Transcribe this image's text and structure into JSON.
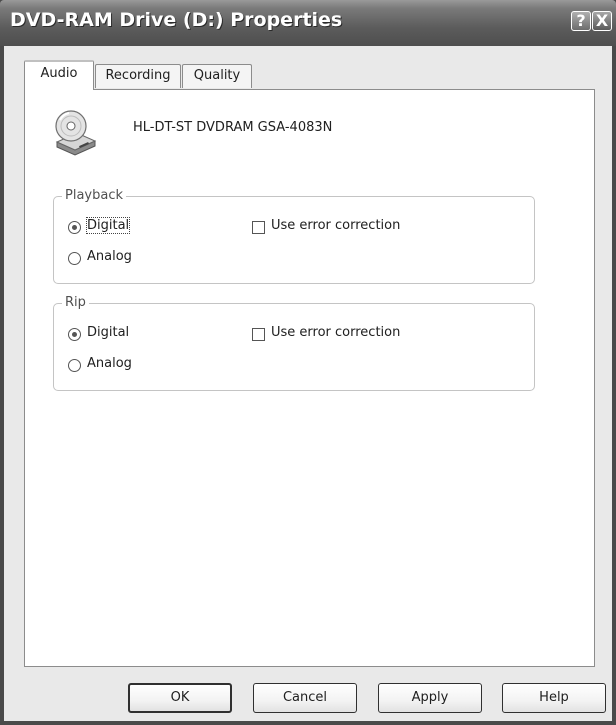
{
  "window": {
    "title": "DVD-RAM Drive (D:) Properties",
    "help_glyph": "?",
    "close_glyph": "X"
  },
  "tabs": [
    {
      "label": "Audio",
      "active": true
    },
    {
      "label": "Recording",
      "active": false
    },
    {
      "label": "Quality",
      "active": false
    }
  ],
  "drive": {
    "icon": "cd-drive-icon",
    "name": "HL-DT-ST DVDRAM GSA-4083N"
  },
  "playback": {
    "label": "Playback",
    "digital_label": "Digital",
    "analog_label": "Analog",
    "selected": "Digital",
    "error_correction_label": "Use error correction",
    "error_correction_checked": false
  },
  "rip": {
    "label": "Rip",
    "digital_label": "Digital",
    "analog_label": "Analog",
    "selected": "Digital",
    "error_correction_label": "Use error correction",
    "error_correction_checked": false
  },
  "buttons": {
    "ok": "OK",
    "cancel": "Cancel",
    "apply": "Apply",
    "help": "Help"
  }
}
